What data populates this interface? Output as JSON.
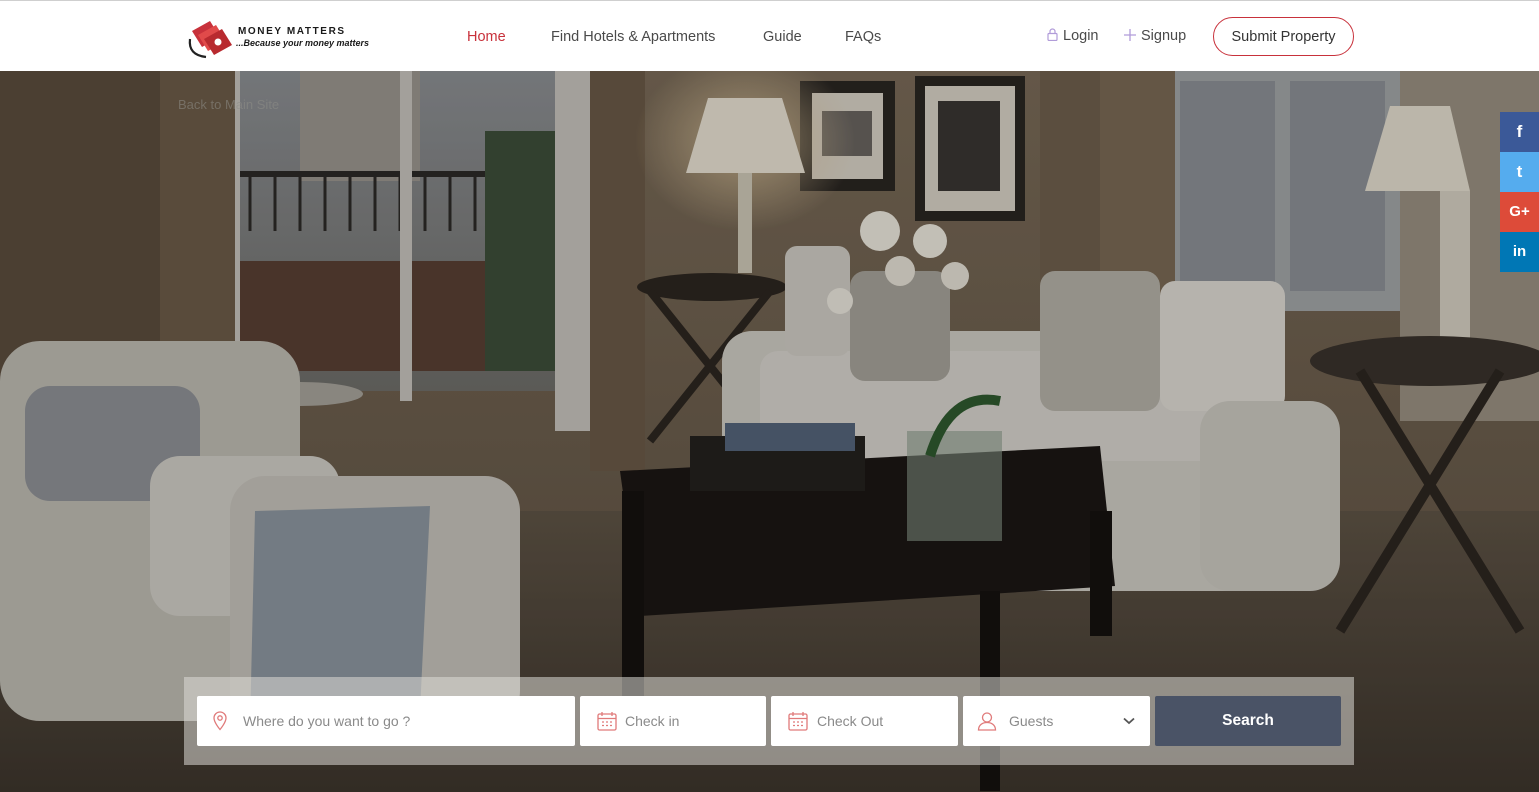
{
  "brand": {
    "name": "MONEY MATTERS",
    "tagline": "...Because your money matters",
    "logo_icon": "money-bills-icon",
    "accent_color": "#c8313b"
  },
  "nav": {
    "items": [
      {
        "label": "Home",
        "active": true
      },
      {
        "label": "Find Hotels & Apartments",
        "active": false
      },
      {
        "label": "Guide",
        "active": false
      },
      {
        "label": "FAQs",
        "active": false
      }
    ]
  },
  "auth": {
    "login": {
      "label": "Login",
      "icon": "lock-icon"
    },
    "signup": {
      "label": "Signup",
      "icon": "plus-icon"
    },
    "submit_property": "Submit Property"
  },
  "hero": {
    "back_link": "Back to Main Site"
  },
  "social": [
    {
      "name": "facebook",
      "glyph": "f",
      "color": "#3b5998"
    },
    {
      "name": "twitter",
      "glyph": "t",
      "color": "#55acee"
    },
    {
      "name": "google-plus",
      "glyph": "G+",
      "color": "#dd4b39"
    },
    {
      "name": "linkedin",
      "glyph": "in",
      "color": "#0077b5"
    }
  ],
  "search": {
    "destination": {
      "placeholder": "Where do you want to go ?",
      "icon": "map-pin-icon"
    },
    "check_in": {
      "placeholder": "Check in",
      "icon": "calendar-icon"
    },
    "check_out": {
      "placeholder": "Check Out",
      "icon": "calendar-icon"
    },
    "guests": {
      "placeholder": "Guests",
      "icon": "user-icon"
    },
    "button": "Search",
    "button_color": "#4a5366"
  }
}
